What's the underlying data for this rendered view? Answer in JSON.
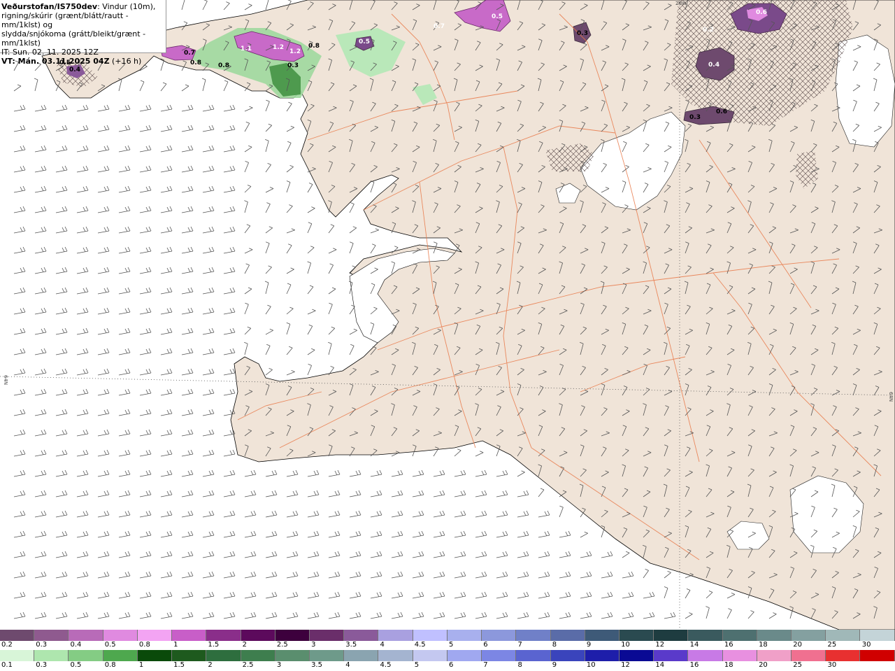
{
  "header": {
    "source": "Veðurstofan/IS750dev",
    "description_1": ": Vindur (10m),",
    "description_2": "rigning/skúrir (grænt/blátt/rautt - mm/1klst) og",
    "description_3": "slydda/snjókoma (grátt/bleikt/grænt - mm/1klst)",
    "issue_time": "IT: Sun. 02. 11. 2025 12Z",
    "valid_time_label": "VT: Mán. 03.11.2025 04Z",
    "valid_time_offset": " (+16 h)"
  },
  "map_labels": {
    "grid_label_left": "64N",
    "grid_label_right": "64N",
    "meridian_label": "20W"
  },
  "precip_values": [
    "0.5",
    "0.4",
    "0.7",
    "0.8",
    "0.8",
    "1.1",
    "1.2",
    "1.2",
    "0.8",
    "0.5",
    "0.7",
    "0.5",
    "0.6",
    "0.3",
    "0.6",
    "0.2",
    "0.4",
    "0.3",
    "0.3"
  ],
  "legend": {
    "snow_scale": {
      "labels": [
        "0.2",
        "0.3",
        "0.4",
        "0.5",
        "0.8",
        "1",
        "1.5",
        "2",
        "2.5",
        "3",
        "3.5",
        "4",
        "4.5",
        "5",
        "6",
        "7",
        "8",
        "9",
        "10",
        "12",
        "14",
        "16",
        "18",
        "20",
        "25",
        "30"
      ],
      "colors": [
        "#6e4a6e",
        "#8f5a8f",
        "#b86bb8",
        "#e08ae0",
        "#f3a4f3",
        "#c85ec8",
        "#8a2e8a",
        "#5c0a5c",
        "#3d003d",
        "#6a2e6a",
        "#8a5a9a",
        "#a9a0e0",
        "#c0c0ff",
        "#a8b0ee",
        "#8c98dc",
        "#7080c8",
        "#5a6ca8",
        "#3e5a78",
        "#2a4a50",
        "#1e3c40",
        "#3a5a5e",
        "#4e7070",
        "#6a8a8a",
        "#84a0a0",
        "#a0b8b8",
        "#c4d4d8"
      ]
    },
    "rain_scale": {
      "labels": [
        "0.1",
        "0.3",
        "0.5",
        "0.8",
        "1",
        "1.5",
        "2",
        "2.5",
        "3",
        "3.5",
        "4",
        "4.5",
        "5",
        "6",
        "7",
        "8",
        "9",
        "10",
        "12",
        "14",
        "16",
        "18",
        "20",
        "25",
        "30"
      ],
      "colors": [
        "#d8f5d8",
        "#aee6ae",
        "#84cc84",
        "#4ea84e",
        "#0a4a0a",
        "#1e5a1e",
        "#2e6e3e",
        "#3e7e4e",
        "#5a8e6e",
        "#6e9a8a",
        "#8aa4b0",
        "#a4b4d0",
        "#c4c8f0",
        "#a0a8f0",
        "#7c86e4",
        "#5a64d0",
        "#3a44bc",
        "#1e1eaa",
        "#0a0a94",
        "#5a3aca",
        "#c87ae6",
        "#e890e0",
        "#f0a0c8",
        "#f07090",
        "#e83030",
        "#d00000"
      ]
    }
  }
}
